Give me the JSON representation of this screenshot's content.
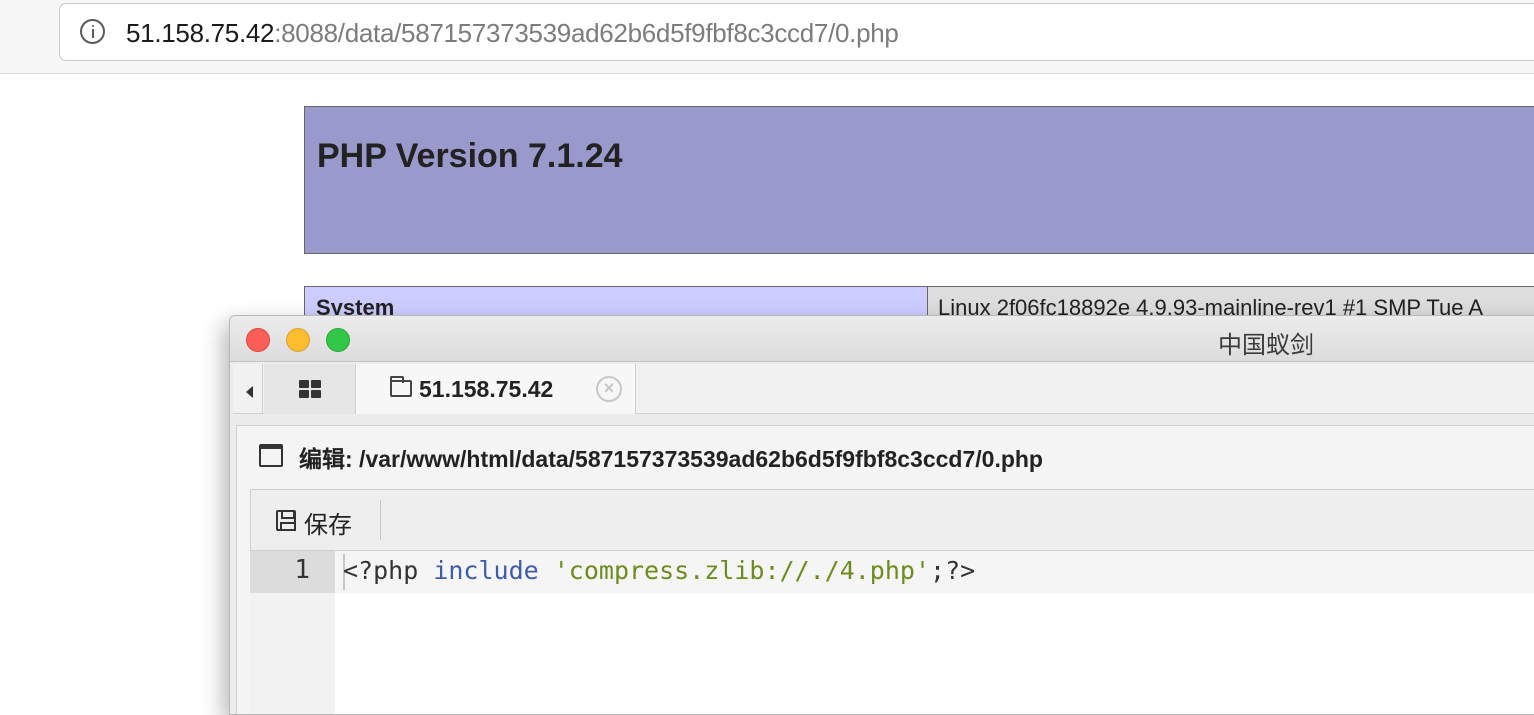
{
  "browser": {
    "url_host": "51.158.75.42",
    "url_rest": ":8088/data/587157373539ad62b6d5f9fbf8c3ccd7/0.php"
  },
  "phpinfo": {
    "title": "PHP Version 7.1.24",
    "row_key": "System",
    "row_value": "Linux 2f06fc18892e 4.9.93-mainline-rev1 #1 SMP Tue A"
  },
  "antsword": {
    "window_title": "中国蚁剑",
    "tabs": {
      "host_label": "51.158.75.42",
      "close_glyph": "×"
    },
    "editor": {
      "title": "编辑: /var/www/html/data/587157373539ad62b6d5f9fbf8c3ccd7/0.php",
      "save_label": "保存",
      "lines": [
        {
          "number": "1",
          "open_tag": "<?php ",
          "keyword": "include",
          "space": " ",
          "string": "'compress.zlib://./4.php'",
          "close": ";?>"
        }
      ]
    },
    "icons": [
      "chevron-left-icon",
      "grid-icon",
      "folder-icon",
      "close-icon",
      "window-icon",
      "save-icon"
    ],
    "colors": {
      "traffic_red": "#fc5f57",
      "traffic_yellow": "#fdbd2e",
      "traffic_green": "#33c748",
      "php_header": "#9999cc",
      "php_key": "#ccccff",
      "code_keyword": "#3d5ea6",
      "code_string": "#6f8a1e"
    }
  }
}
